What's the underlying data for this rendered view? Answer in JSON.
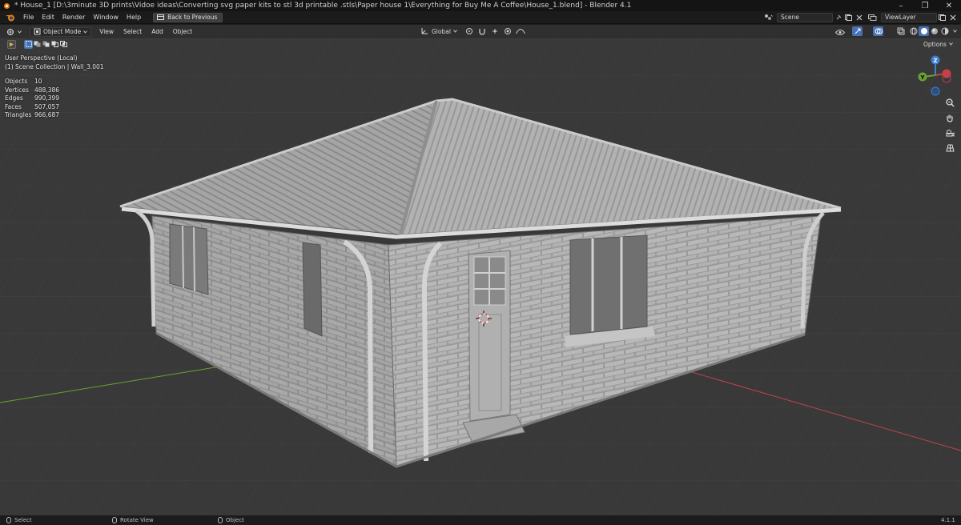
{
  "window": {
    "title": "* House_1 [D:\\3minute 3D prints\\Vidoe ideas\\Converting svg paper kits to stl 3d printable .stls\\Paper house 1\\Everything for Buy Me A Coffee\\House_1.blend] - Blender 4.1"
  },
  "menubar": {
    "items": [
      "File",
      "Edit",
      "Render",
      "Window",
      "Help"
    ],
    "back_label": "Back to Previous",
    "scene": "Scene",
    "view_layer": "ViewLayer"
  },
  "viewport_header": {
    "mode": "Object Mode",
    "menus": [
      "View",
      "Select",
      "Add",
      "Object"
    ],
    "orientation": "Global"
  },
  "overlay": {
    "perspective": "User Perspective (Local)",
    "collection": "(1) Scene Collection | Wall_3.001",
    "stats": [
      {
        "label": "Objects",
        "value": "10"
      },
      {
        "label": "Vertices",
        "value": "488,386"
      },
      {
        "label": "Edges",
        "value": "990,399"
      },
      {
        "label": "Faces",
        "value": "507,057"
      },
      {
        "label": "Triangles",
        "value": "966,687"
      }
    ],
    "options_label": "Options"
  },
  "gizmo": {
    "x": "X",
    "y": "Y",
    "z": "Z"
  },
  "statusbar": {
    "select": "Select",
    "rotate": "Rotate View",
    "object": "Object",
    "version": "4.1.1"
  },
  "colors": {
    "viewport_bg": "#393939",
    "header_bg": "#2f2f2f",
    "axis_x": "#c4414b",
    "axis_y": "#6ba131",
    "axis_z": "#3d7fd1",
    "active_blue": "#4772b3"
  }
}
